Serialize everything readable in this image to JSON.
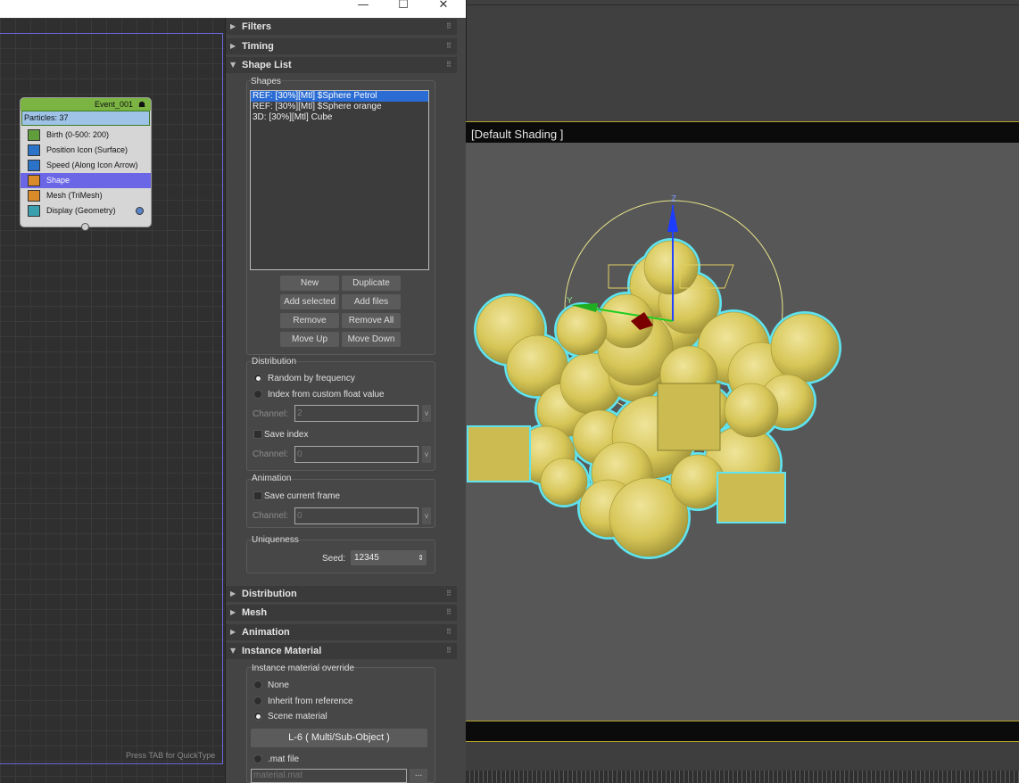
{
  "window": {
    "controls": [
      "—",
      "☐",
      "✕"
    ]
  },
  "graph": {
    "event": {
      "name": "Event_001",
      "particles": "Particles: 37",
      "operators": [
        {
          "label": "Birth (0-500: 200)",
          "icon": "birth-icon",
          "color": "#5f9e3a"
        },
        {
          "label": "Position Icon (Surface)",
          "icon": "position-icon",
          "color": "#2b72c9"
        },
        {
          "label": "Speed (Along Icon Arrow)",
          "icon": "speed-icon",
          "color": "#2b72c9"
        },
        {
          "label": "Shape",
          "icon": "shape-icon",
          "color": "#d98b2a"
        },
        {
          "label": "Mesh (TriMesh)",
          "icon": "mesh-icon",
          "color": "#d98b2a"
        },
        {
          "label": "Display (Geometry)",
          "icon": "display-icon",
          "color": "#3aa0b0"
        }
      ]
    },
    "hint": "Press TAB for QuickType"
  },
  "panel": {
    "rollouts_top": [
      "Filters",
      "Timing",
      "Shape List"
    ],
    "shapes": {
      "title": "Shapes",
      "items": [
        "REF: [30%][Mtl] $Sphere Petrol",
        "REF: [30%][Mtl] $Sphere orange",
        "3D: [30%][Mtl] Cube"
      ],
      "buttons": [
        "New",
        "Duplicate",
        "Add selected",
        "Add files",
        "Remove",
        "Remove All",
        "Move Up",
        "Move Down"
      ]
    },
    "distribution": {
      "title": "Distribution",
      "opt1": "Random by frequency",
      "opt2": "Index from custom float value",
      "channel_label": "Channel:",
      "channel1_value": "2",
      "save_index": "Save index",
      "channel2_value": "0"
    },
    "animation": {
      "title": "Animation",
      "save_frame": "Save current frame",
      "channel_value": "0"
    },
    "uniqueness": {
      "title": "Uniqueness",
      "seed_label": "Seed:",
      "seed_value": "12345"
    },
    "rollouts_bottom": [
      "Distribution",
      "Mesh",
      "Animation",
      "Instance Material"
    ],
    "instance_material": {
      "title": "Instance material override",
      "none": "None",
      "inherit": "Inherit from reference",
      "scene": "Scene material",
      "material_button": "L-6  ( Multi/Sub-Object )",
      "mat_file": ".mat file",
      "mat_file_placeholder": "material.mat",
      "browse": "..."
    }
  },
  "viewport": {
    "label": "[Default Shading ]",
    "gizmo_z": "Z",
    "gizmo_y": "Y",
    "particle_color": "#d8c85a",
    "outline_color": "#5fe3ef"
  }
}
